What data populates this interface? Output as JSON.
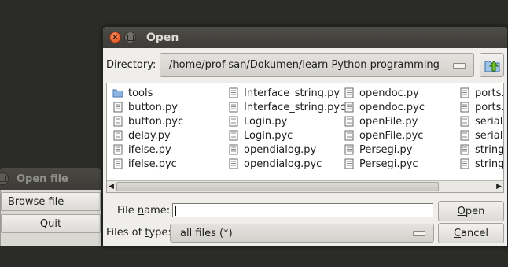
{
  "background_window": {
    "title": "Open file",
    "buttons": [
      {
        "label": "Browse file"
      },
      {
        "label": "Quit"
      }
    ]
  },
  "dialog": {
    "title": "Open",
    "directory_label_first": "D",
    "directory_label_rest": "irectory:",
    "directory_value": "/home/prof-san/Dokumen/learn Python programming",
    "files": {
      "columns": [
        [
          {
            "name": "tools",
            "icon": "folder-icon"
          },
          {
            "name": "button.py",
            "icon": "file-icon"
          },
          {
            "name": "button.pyc",
            "icon": "file-icon"
          },
          {
            "name": "delay.py",
            "icon": "file-icon"
          },
          {
            "name": "ifelse.py",
            "icon": "file-icon"
          },
          {
            "name": "ifelse.pyc",
            "icon": "file-icon"
          }
        ],
        [
          {
            "name": "Interface_string.py",
            "icon": "file-icon"
          },
          {
            "name": "Interface_string.pyc",
            "icon": "file-icon"
          },
          {
            "name": "Login.py",
            "icon": "file-icon"
          },
          {
            "name": "Login.pyc",
            "icon": "file-icon"
          },
          {
            "name": "opendialog.py",
            "icon": "file-icon"
          },
          {
            "name": "opendialog.pyc",
            "icon": "file-icon"
          }
        ],
        [
          {
            "name": "opendoc.py",
            "icon": "file-icon"
          },
          {
            "name": "opendoc.pyc",
            "icon": "file-icon"
          },
          {
            "name": "openFile.py",
            "icon": "file-icon"
          },
          {
            "name": "openFile.pyc",
            "icon": "file-icon"
          },
          {
            "name": "Persegi.py",
            "icon": "file-icon"
          },
          {
            "name": "Persegi.pyc",
            "icon": "file-icon"
          }
        ],
        [
          {
            "name": "ports.",
            "icon": "file-icon"
          },
          {
            "name": "ports.",
            "icon": "file-icon"
          },
          {
            "name": "seriala",
            "icon": "file-icon"
          },
          {
            "name": "seriala",
            "icon": "file-icon"
          },
          {
            "name": "string.",
            "icon": "file-icon"
          },
          {
            "name": "string.",
            "icon": "file-icon"
          }
        ]
      ]
    },
    "file_name_label_a": "File ",
    "file_name_label_u": "n",
    "file_name_label_b": "ame:",
    "file_name_value": "",
    "files_of_type_label_a": "Files of ",
    "files_of_type_label_u": "t",
    "files_of_type_label_b": "ype:",
    "files_of_type_value": "all files (*)",
    "open_button_u": "O",
    "open_button_rest": "pen",
    "cancel_button_u": "C",
    "cancel_button_rest": "ancel"
  },
  "colors": {
    "titlebar": "#3d3c38",
    "close_button": "#df4a16",
    "folder": "#5f8fc8",
    "up_arrow": "#4e9a06"
  }
}
